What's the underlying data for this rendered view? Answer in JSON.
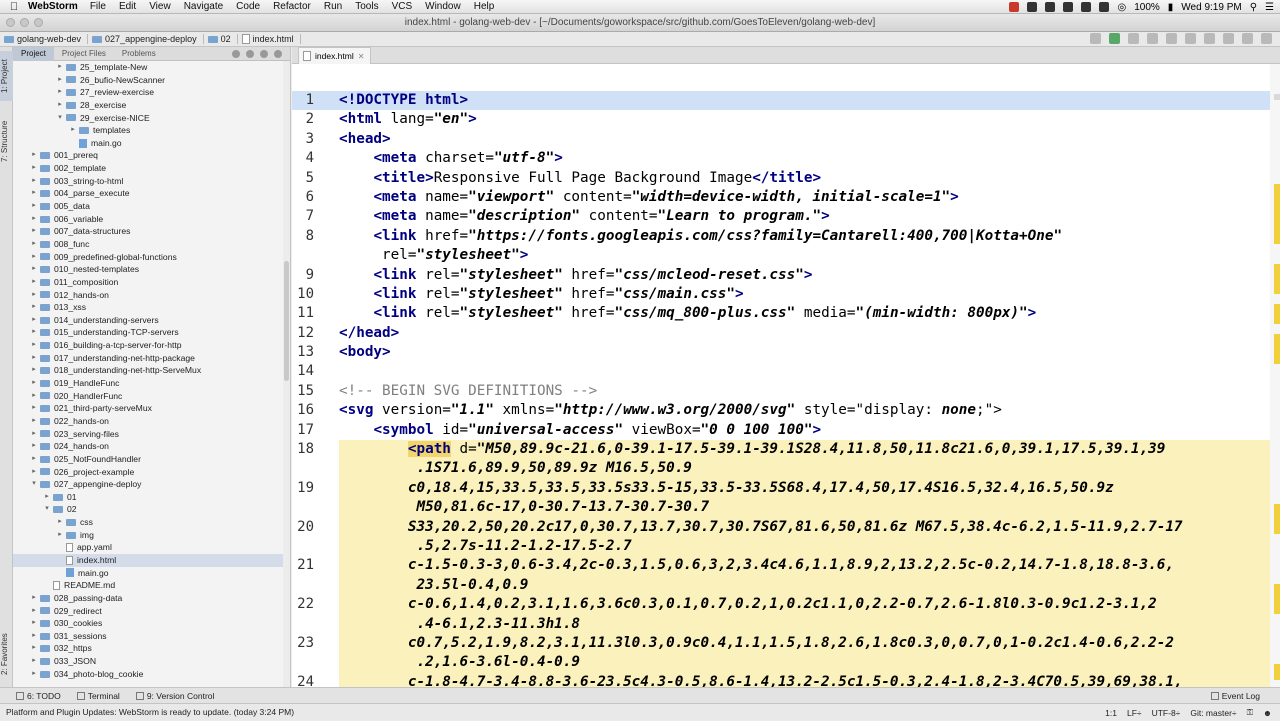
{
  "menubar": {
    "app_name": "WebStorm",
    "items": [
      "File",
      "Edit",
      "View",
      "Navigate",
      "Code",
      "Refactor",
      "Run",
      "Tools",
      "VCS",
      "Window",
      "Help"
    ],
    "battery": "100%",
    "clock": "Wed 9:19 PM"
  },
  "window": {
    "title": "index.html - golang-web-dev - [~/Documents/goworkspace/src/github.com/GoesToEleven/golang-web-dev]"
  },
  "breadcrumb": [
    "golang-web-dev",
    "027_appengine-deploy",
    "02",
    "index.html"
  ],
  "left_tabs": {
    "project": "1: Project",
    "structure": "7: Structure",
    "favorites": "2: Favorites"
  },
  "panel": {
    "tabs": [
      "Project",
      "Project Files",
      "Problems"
    ],
    "tree": [
      {
        "label": "25_template-New",
        "kind": "folder",
        "depth": 3,
        "arrow": "right"
      },
      {
        "label": "26_bufio-NewScanner",
        "kind": "folder",
        "depth": 3,
        "arrow": "right"
      },
      {
        "label": "27_review-exercise",
        "kind": "folder",
        "depth": 3,
        "arrow": "right"
      },
      {
        "label": "28_exercise",
        "kind": "folder",
        "depth": 3,
        "arrow": "right"
      },
      {
        "label": "29_exercise-NICE",
        "kind": "folder",
        "depth": 3,
        "arrow": "down"
      },
      {
        "label": "templates",
        "kind": "folder",
        "depth": 4,
        "arrow": "right"
      },
      {
        "label": "main.go",
        "kind": "go",
        "depth": 4,
        "arrow": ""
      },
      {
        "label": "001_prereq",
        "kind": "folder",
        "depth": 1,
        "arrow": "right"
      },
      {
        "label": "002_template",
        "kind": "folder",
        "depth": 1,
        "arrow": "right"
      },
      {
        "label": "003_string-to-html",
        "kind": "folder",
        "depth": 1,
        "arrow": "right"
      },
      {
        "label": "004_parse_execute",
        "kind": "folder",
        "depth": 1,
        "arrow": "right"
      },
      {
        "label": "005_data",
        "kind": "folder",
        "depth": 1,
        "arrow": "right"
      },
      {
        "label": "006_variable",
        "kind": "folder",
        "depth": 1,
        "arrow": "right"
      },
      {
        "label": "007_data-structures",
        "kind": "folder",
        "depth": 1,
        "arrow": "right"
      },
      {
        "label": "008_func",
        "kind": "folder",
        "depth": 1,
        "arrow": "right"
      },
      {
        "label": "009_predefined-global-functions",
        "kind": "folder",
        "depth": 1,
        "arrow": "right"
      },
      {
        "label": "010_nested-templates",
        "kind": "folder",
        "depth": 1,
        "arrow": "right"
      },
      {
        "label": "011_composition",
        "kind": "folder",
        "depth": 1,
        "arrow": "right"
      },
      {
        "label": "012_hands-on",
        "kind": "folder",
        "depth": 1,
        "arrow": "right"
      },
      {
        "label": "013_xss",
        "kind": "folder",
        "depth": 1,
        "arrow": "right"
      },
      {
        "label": "014_understanding-servers",
        "kind": "folder",
        "depth": 1,
        "arrow": "right"
      },
      {
        "label": "015_understanding-TCP-servers",
        "kind": "folder",
        "depth": 1,
        "arrow": "right"
      },
      {
        "label": "016_building-a-tcp-server-for-http",
        "kind": "folder",
        "depth": 1,
        "arrow": "right"
      },
      {
        "label": "017_understanding-net-http-package",
        "kind": "folder",
        "depth": 1,
        "arrow": "right"
      },
      {
        "label": "018_understanding-net-http-ServeMux",
        "kind": "folder",
        "depth": 1,
        "arrow": "right"
      },
      {
        "label": "019_HandleFunc",
        "kind": "folder",
        "depth": 1,
        "arrow": "right"
      },
      {
        "label": "020_HandlerFunc",
        "kind": "folder",
        "depth": 1,
        "arrow": "right"
      },
      {
        "label": "021_third-party-serveMux",
        "kind": "folder",
        "depth": 1,
        "arrow": "right"
      },
      {
        "label": "022_hands-on",
        "kind": "folder",
        "depth": 1,
        "arrow": "right"
      },
      {
        "label": "023_serving-files",
        "kind": "folder",
        "depth": 1,
        "arrow": "right"
      },
      {
        "label": "024_hands-on",
        "kind": "folder",
        "depth": 1,
        "arrow": "right"
      },
      {
        "label": "025_NotFoundHandler",
        "kind": "folder",
        "depth": 1,
        "arrow": "right"
      },
      {
        "label": "026_project-example",
        "kind": "folder",
        "depth": 1,
        "arrow": "right"
      },
      {
        "label": "027_appengine-deploy",
        "kind": "folder",
        "depth": 1,
        "arrow": "down"
      },
      {
        "label": "01",
        "kind": "folder",
        "depth": 2,
        "arrow": "right"
      },
      {
        "label": "02",
        "kind": "folder",
        "depth": 2,
        "arrow": "down"
      },
      {
        "label": "css",
        "kind": "folder",
        "depth": 3,
        "arrow": "right"
      },
      {
        "label": "img",
        "kind": "folder",
        "depth": 3,
        "arrow": "right"
      },
      {
        "label": "app.yaml",
        "kind": "file",
        "depth": 3,
        "arrow": ""
      },
      {
        "label": "index.html",
        "kind": "file",
        "depth": 3,
        "arrow": "",
        "selected": true
      },
      {
        "label": "main.go",
        "kind": "go",
        "depth": 3,
        "arrow": ""
      },
      {
        "label": "README.md",
        "kind": "file",
        "depth": 2,
        "arrow": ""
      },
      {
        "label": "028_passing-data",
        "kind": "folder",
        "depth": 1,
        "arrow": "right"
      },
      {
        "label": "029_redirect",
        "kind": "folder",
        "depth": 1,
        "arrow": "right"
      },
      {
        "label": "030_cookies",
        "kind": "folder",
        "depth": 1,
        "arrow": "right"
      },
      {
        "label": "031_sessions",
        "kind": "folder",
        "depth": 1,
        "arrow": "right"
      },
      {
        "label": "032_https",
        "kind": "folder",
        "depth": 1,
        "arrow": "right"
      },
      {
        "label": "033_JSON",
        "kind": "folder",
        "depth": 1,
        "arrow": "right"
      },
      {
        "label": "034_photo-blog_cookie",
        "kind": "folder",
        "depth": 1,
        "arrow": "right"
      }
    ]
  },
  "editor": {
    "tab_label": "index.html",
    "lines": [
      {
        "n": "1",
        "parts": [
          [
            "tag",
            "<!DOCTYPE html>"
          ]
        ],
        "current": true
      },
      {
        "n": "2",
        "parts": [
          [
            "tag",
            "<html"
          ],
          [
            "attr",
            " lang="
          ],
          [
            "str",
            "\"en\""
          ],
          [
            "tag",
            ">"
          ]
        ]
      },
      {
        "n": "3",
        "parts": [
          [
            "tag",
            "<head>"
          ]
        ]
      },
      {
        "n": "4",
        "parts": [
          [
            "attr",
            "    "
          ],
          [
            "tag",
            "<meta"
          ],
          [
            "attr",
            " charset="
          ],
          [
            "str",
            "\"utf-8\""
          ],
          [
            "tag",
            ">"
          ]
        ]
      },
      {
        "n": "5",
        "parts": [
          [
            "attr",
            "    "
          ],
          [
            "tag",
            "<title>"
          ],
          [
            "attr",
            "Responsive Full Page Background Image"
          ],
          [
            "tag",
            "</title>"
          ]
        ]
      },
      {
        "n": "6",
        "parts": [
          [
            "attr",
            "    "
          ],
          [
            "tag",
            "<meta"
          ],
          [
            "attr",
            " name="
          ],
          [
            "str",
            "\"viewport\""
          ],
          [
            "attr",
            " content="
          ],
          [
            "str",
            "\"width=device-width, initial-scale=1\""
          ],
          [
            "tag",
            ">"
          ]
        ]
      },
      {
        "n": "7",
        "parts": [
          [
            "attr",
            "    "
          ],
          [
            "tag",
            "<meta"
          ],
          [
            "attr",
            " name="
          ],
          [
            "str",
            "\"description\""
          ],
          [
            "attr",
            " content="
          ],
          [
            "str",
            "\"Learn to program.\""
          ],
          [
            "tag",
            ">"
          ]
        ]
      },
      {
        "n": "8",
        "parts": [
          [
            "attr",
            "    "
          ],
          [
            "tag",
            "<link"
          ],
          [
            "attr",
            " href="
          ],
          [
            "str",
            "\"https://fonts.googleapis.com/css?family=Cantarell:400,700|Kotta+One\""
          ]
        ],
        "wrap": [
          [
            "attr",
            "     rel="
          ],
          [
            "str",
            "\"stylesheet\""
          ],
          [
            "tag",
            ">"
          ]
        ]
      },
      {
        "n": "9",
        "parts": [
          [
            "attr",
            "    "
          ],
          [
            "tag",
            "<link"
          ],
          [
            "attr",
            " rel="
          ],
          [
            "str",
            "\"stylesheet\""
          ],
          [
            "attr",
            " href="
          ],
          [
            "str",
            "\"css/mcleod-reset.css\""
          ],
          [
            "tag",
            ">"
          ]
        ]
      },
      {
        "n": "10",
        "parts": [
          [
            "attr",
            "    "
          ],
          [
            "tag",
            "<link"
          ],
          [
            "attr",
            " rel="
          ],
          [
            "str",
            "\"stylesheet\""
          ],
          [
            "attr",
            " href="
          ],
          [
            "str",
            "\"css/main.css\""
          ],
          [
            "tag",
            ">"
          ]
        ]
      },
      {
        "n": "11",
        "parts": [
          [
            "attr",
            "    "
          ],
          [
            "tag",
            "<link"
          ],
          [
            "attr",
            " rel="
          ],
          [
            "str",
            "\"stylesheet\""
          ],
          [
            "attr",
            " href="
          ],
          [
            "str",
            "\"css/mq_800-plus.css\""
          ],
          [
            "attr",
            " media="
          ],
          [
            "str",
            "\"(min-width: 800px)\""
          ],
          [
            "tag",
            ">"
          ]
        ]
      },
      {
        "n": "12",
        "parts": [
          [
            "tag",
            "</head>"
          ]
        ]
      },
      {
        "n": "13",
        "parts": [
          [
            "tag",
            "<body>"
          ]
        ]
      },
      {
        "n": "14",
        "parts": []
      },
      {
        "n": "15",
        "parts": [
          [
            "cmt",
            "<!-- BEGIN SVG DEFINITIONS -->"
          ]
        ]
      },
      {
        "n": "16",
        "parts": [
          [
            "tag",
            "<svg"
          ],
          [
            "attr",
            " version="
          ],
          [
            "str",
            "\"1.1\""
          ],
          [
            "attr",
            " xmlns="
          ],
          [
            "str",
            "\"http://www.w3.org/2000/svg\""
          ],
          [
            "attr",
            " style=\"display: "
          ],
          [
            "str",
            "none"
          ],
          [
            "attr",
            ";\">"
          ]
        ]
      },
      {
        "n": "17",
        "parts": [
          [
            "attr",
            "    "
          ],
          [
            "tag",
            "<symbol"
          ],
          [
            "attr",
            " id="
          ],
          [
            "str",
            "\"universal-access\""
          ],
          [
            "attr",
            " viewBox="
          ],
          [
            "str",
            "\"0 0 100 100\""
          ],
          [
            "tag",
            ">"
          ]
        ]
      },
      {
        "n": "18",
        "parts": [
          [
            "attr",
            "        "
          ],
          [
            "pathtag",
            "<path"
          ],
          [
            "attr",
            " d="
          ],
          [
            "str",
            "\"M50,89.9c-21.6,0-39.1-17.5-39.1-39.1S28.4,11.8,50,11.8c21.6,0,39.1,17.5,39.1,39"
          ]
        ],
        "wrap": [
          [
            "str",
            "         .1S71.6,89.9,50,89.9z M16.5,50.9"
          ]
        ],
        "hl": true
      },
      {
        "n": "19",
        "parts": [
          [
            "str",
            "        c0,18.4,15,33.5,33.5,33.5s33.5-15,33.5-33.5S68.4,17.4,50,17.4S16.5,32.4,16.5,50.9z"
          ]
        ],
        "wrap": [
          [
            "str",
            "         M50,81.6c-17,0-30.7-13.7-30.7-30.7"
          ]
        ],
        "hl": true
      },
      {
        "n": "20",
        "parts": [
          [
            "str",
            "        S33,20.2,50,20.2c17,0,30.7,13.7,30.7,30.7S67,81.6,50,81.6z M67.5,38.4c-6.2,1.5-11.9,2.7-17"
          ]
        ],
        "wrap": [
          [
            "str",
            "         .5,2.7s-11.2-1.2-17.5-2.7"
          ]
        ],
        "hl": true
      },
      {
        "n": "21",
        "parts": [
          [
            "str",
            "        c-1.5-0.3-3,0.6-3.4,2c-0.3,1.5,0.6,3,2,3.4c4.6,1.1,8.9,2,13.2,2.5c-0.2,14.7-1.8,18.8-3.6,"
          ]
        ],
        "wrap": [
          [
            "str",
            "         23.5l-0.4,0.9"
          ]
        ],
        "hl": true
      },
      {
        "n": "22",
        "parts": [
          [
            "str",
            "        c-0.6,1.4,0.2,3.1,1.6,3.6c0.3,0.1,0.7,0.2,1,0.2c1.1,0,2.2-0.7,2.6-1.8l0.3-0.9c1.2-3.1,2"
          ]
        ],
        "wrap": [
          [
            "str",
            "         .4-6.1,2.3-11.3h1.8"
          ]
        ],
        "hl": true
      },
      {
        "n": "23",
        "parts": [
          [
            "str",
            "        c0.7,5.2,1.9,8.2,3.1,11.3l0.3,0.9c0.4,1.1,1.5,1.8,2.6,1.8c0.3,0,0.7,0,1-0.2c1.4-0.6,2.2-2"
          ]
        ],
        "wrap": [
          [
            "str",
            "         .2,1.6-3.6l-0.4-0.9"
          ]
        ],
        "hl": true
      },
      {
        "n": "24",
        "parts": [
          [
            "str",
            "        c-1.8-4.7-3.4-8.8-3.6-23.5c4.3-0.5,8.6-1.4,13.2-2.5c1.5-0.3,2.4-1.8,2-3.4C70.5,39,69,38.1,"
          ]
        ],
        "hl": true
      }
    ]
  },
  "bottom_tabs": {
    "todo": "6: TODO",
    "terminal": "Terminal",
    "vcs": "9: Version Control",
    "event_log": "Event Log"
  },
  "status": {
    "message": "Platform and Plugin Updates: WebStorm is ready to update. (today 3:24 PM)",
    "position": "1:1",
    "line_sep": "LF÷",
    "encoding": "UTF-8÷",
    "git": "Git: master÷"
  }
}
